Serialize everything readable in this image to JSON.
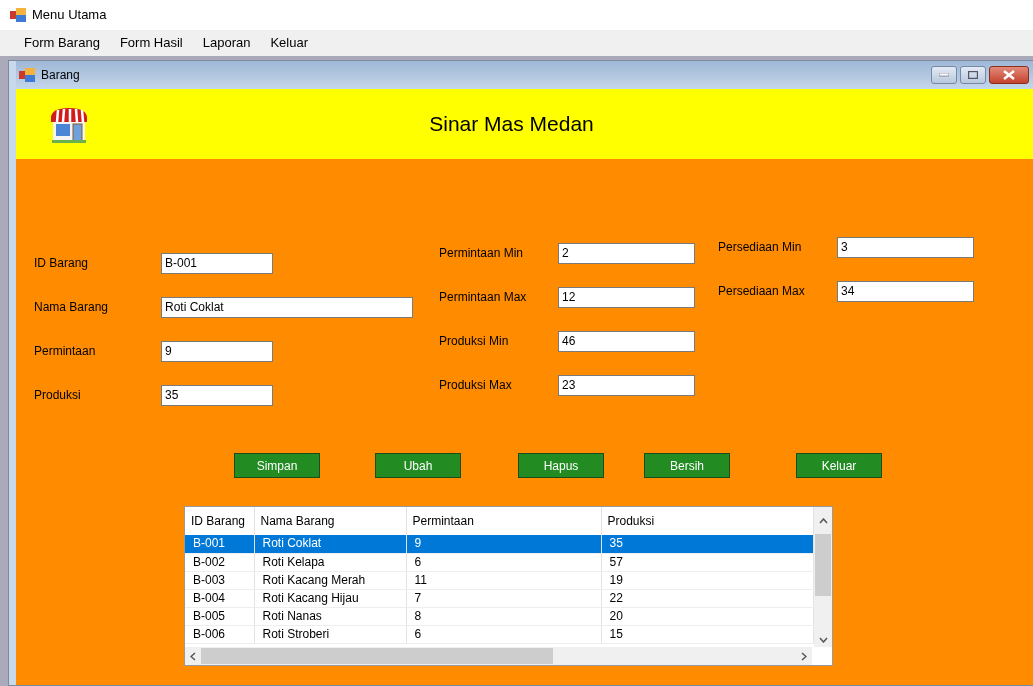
{
  "window": {
    "title": "Menu Utama"
  },
  "menu": [
    "Form Barang",
    "Form Hasil",
    "Laporan",
    "Keluar"
  ],
  "child_window": {
    "title": "Barang"
  },
  "header": {
    "title": "Sinar Mas Medan"
  },
  "field_columns": [
    {
      "fields": [
        {
          "label": "ID Barang",
          "value": "B-001"
        },
        {
          "label": "Nama Barang",
          "value": "Roti Coklat",
          "kind": "wide"
        },
        {
          "label": "Permintaan",
          "value": "9"
        },
        {
          "label": "Produksi",
          "value": "35"
        }
      ]
    },
    {
      "fields": [
        {
          "label": "Permintaan Min",
          "value": "2"
        },
        {
          "label": "Permintaan Max",
          "value": "12"
        },
        {
          "label": "Produksi Min",
          "value": "46"
        },
        {
          "label": "Produksi Max",
          "value": "23"
        }
      ]
    },
    {
      "fields": [
        {
          "label": "Persediaan Min",
          "value": "3"
        },
        {
          "label": "Persediaan Max",
          "value": "34"
        }
      ]
    }
  ],
  "buttons": [
    "Simpan",
    "Ubah",
    "Hapus",
    "Bersih",
    "Keluar"
  ],
  "table": {
    "columns": [
      "ID Barang",
      "Nama Barang",
      "Permintaan",
      "Produksi"
    ],
    "rows": [
      {
        "cells": [
          "B-001",
          "Roti Coklat",
          "9",
          "35"
        ],
        "selected": true
      },
      {
        "cells": [
          "B-002",
          "Roti Kelapa",
          "6",
          "57"
        ],
        "selected": false
      },
      {
        "cells": [
          "B-003",
          "Roti Kacang Merah",
          "11",
          "19"
        ],
        "selected": false
      },
      {
        "cells": [
          "B-004",
          "Roti Kacang Hijau",
          "7",
          "22"
        ],
        "selected": false
      },
      {
        "cells": [
          "B-005",
          "Roti Nanas",
          "8",
          "20"
        ],
        "selected": false
      },
      {
        "cells": [
          "B-006",
          "Roti Stroberi",
          "6",
          "15"
        ],
        "selected": false
      }
    ]
  }
}
